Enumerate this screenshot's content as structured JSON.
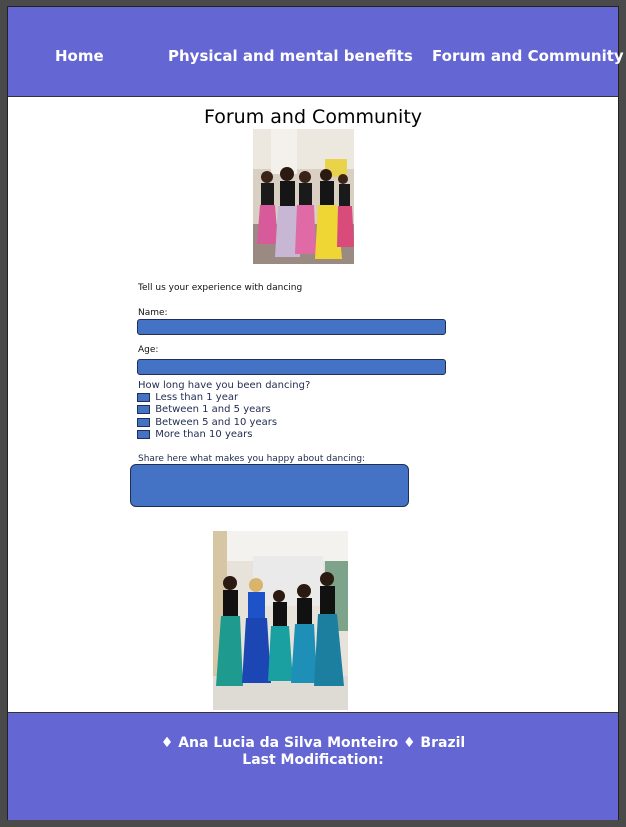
{
  "nav": {
    "home": "Home",
    "benefits": "Physical and mental benefits",
    "forum": "Forum and Community"
  },
  "page_title": "Forum and Community",
  "form": {
    "intro": "Tell us your experience with dancing",
    "name_label": "Name:",
    "age_label": "Age:",
    "duration_question": "How long have you been dancing?",
    "options": [
      "Less than 1 year",
      "Between 1 and 5 years",
      "Between 5 and 10 years",
      "More than 10 years"
    ],
    "share_label": "Share here what makes you happy about dancing:"
  },
  "footer": {
    "line1": "♦ Ana Lucia da Silva Monteiro ♦ Brazil",
    "line2": "Last Modification:"
  },
  "colors": {
    "header_bg": "#6366d3",
    "field_fill": "#4472c4"
  },
  "images": {
    "top_photo": "group-of-dancers-photo",
    "bottom_photo": "dancers-in-blue-costumes-photo"
  }
}
